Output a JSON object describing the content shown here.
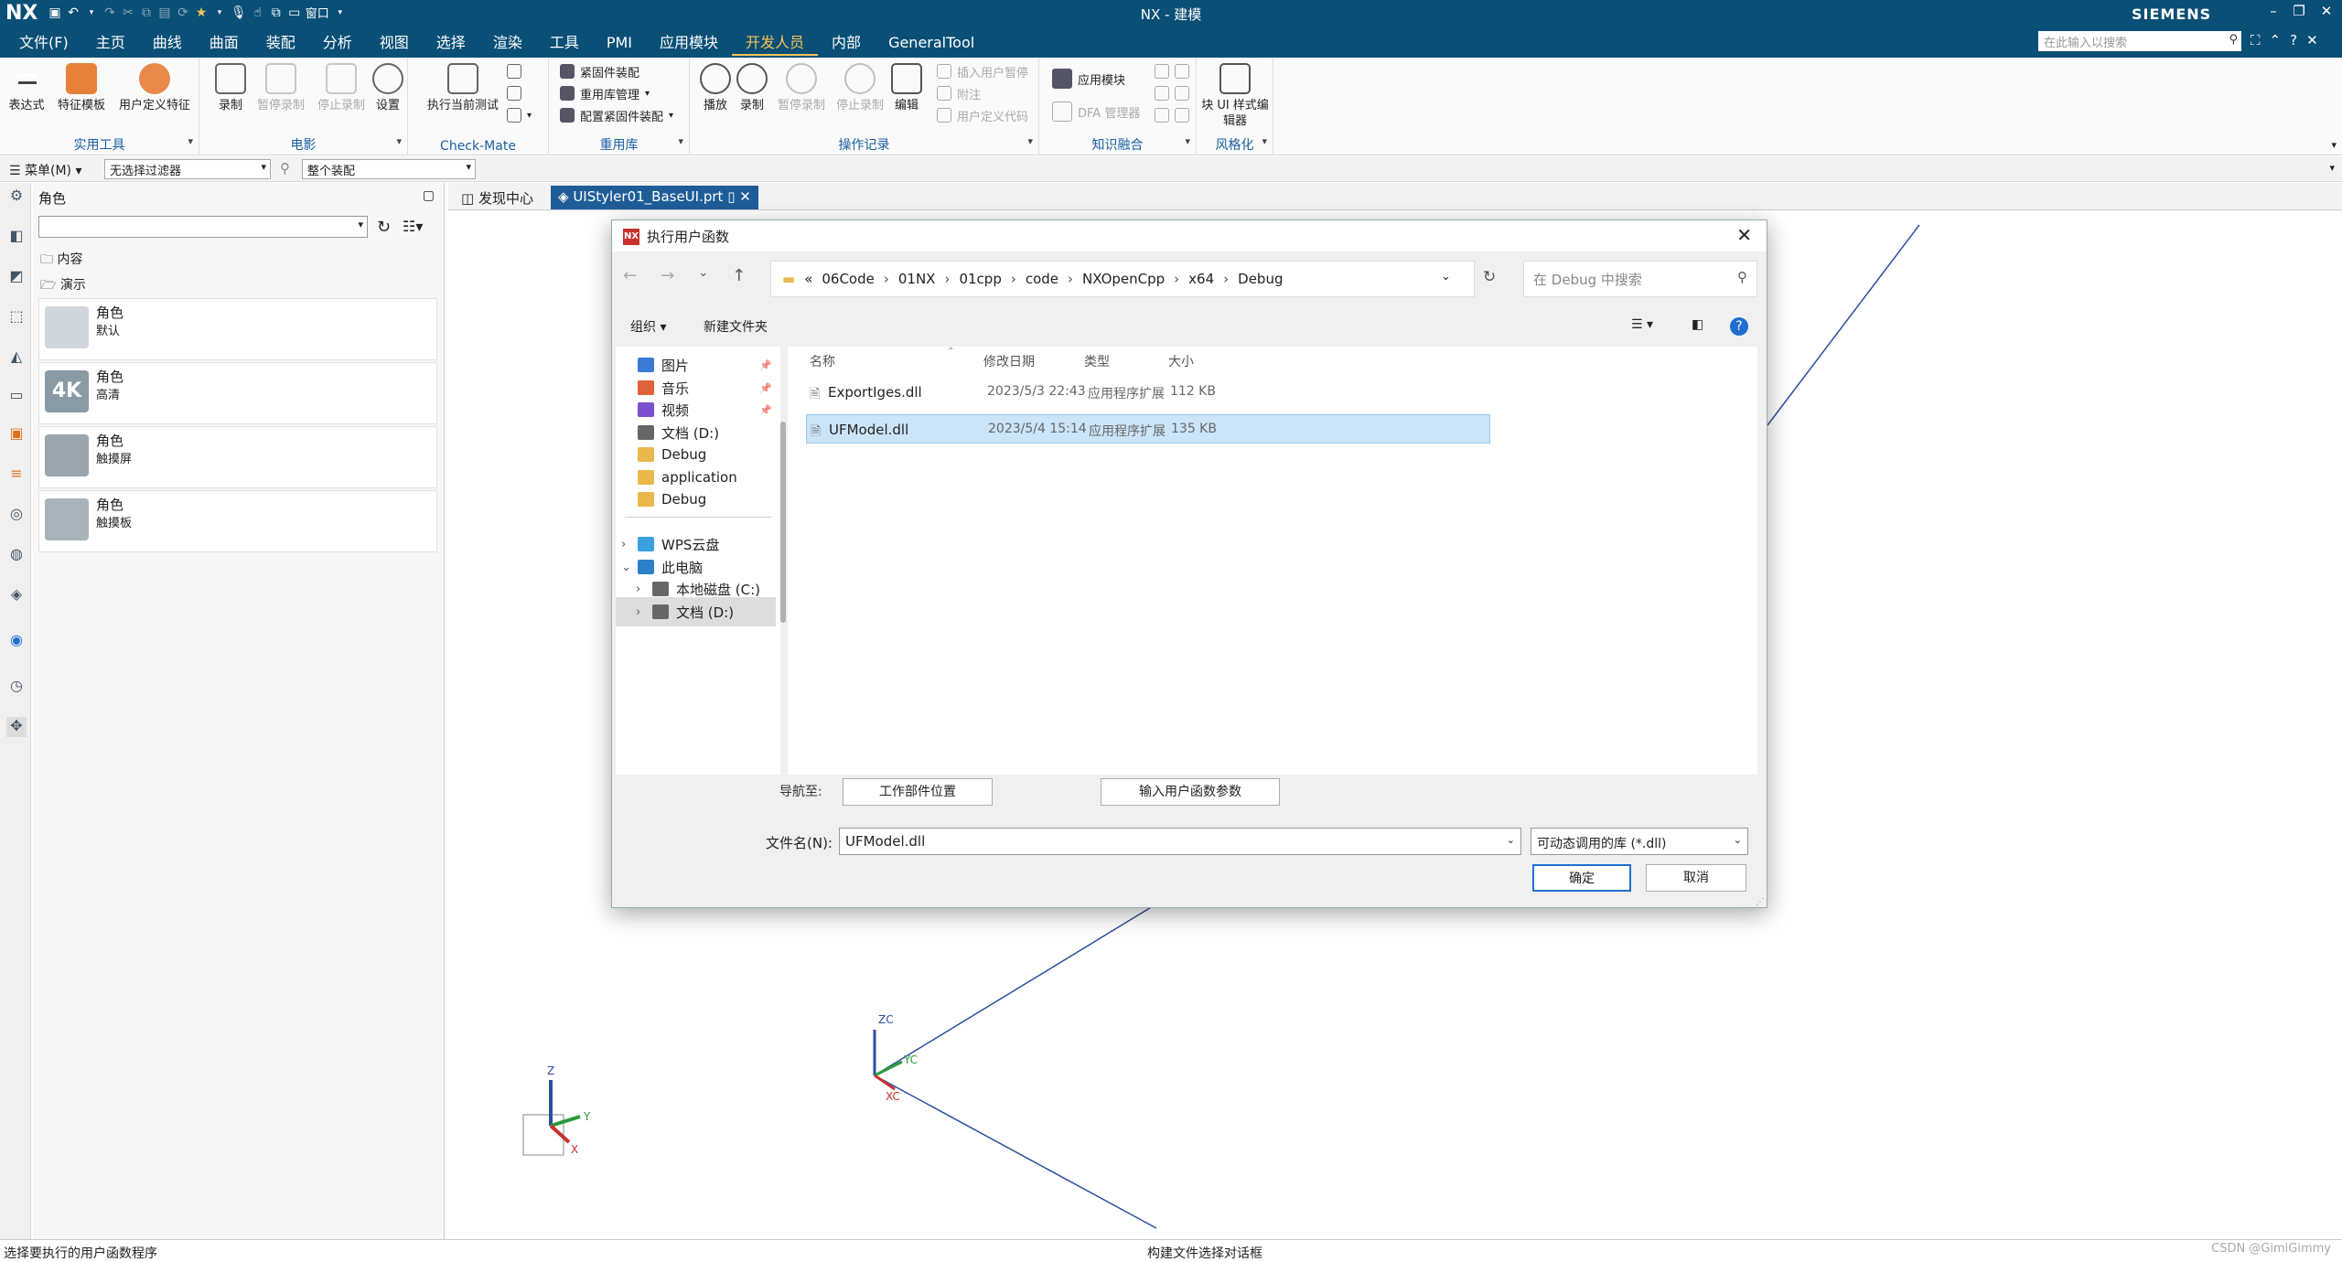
{
  "app": {
    "logo": "NX",
    "title": "NX - 建模",
    "brand": "SIEMENS",
    "quick_access_window": "窗口"
  },
  "menubar": {
    "items": [
      "文件(F)",
      "主页",
      "曲线",
      "曲面",
      "装配",
      "分析",
      "视图",
      "选择",
      "渲染",
      "工具",
      "PMI",
      "应用模块",
      "开发人员",
      "内部",
      "GeneralTool"
    ],
    "active": "开发人员",
    "search_placeholder": "在此输入以搜索"
  },
  "ribbon": {
    "groups": [
      {
        "title": "实用工具",
        "buttons": [
          "表达式",
          "特征模板",
          "用户定义特征"
        ]
      },
      {
        "title": "电影",
        "buttons": [
          "录制",
          "暂停录制",
          "停止录制",
          "设置"
        ]
      },
      {
        "title": "Check-Mate",
        "buttons": [
          "执行当前测试"
        ]
      },
      {
        "title": "重用库",
        "buttons": [
          "紧固件装配",
          "重用库管理",
          "配置紧固件装配"
        ]
      },
      {
        "title": "操作记录",
        "buttons": [
          "播放",
          "录制",
          "暂停录制",
          "停止录制",
          "编辑",
          "插入用户暂停",
          "附注",
          "用户定义代码"
        ]
      },
      {
        "title": "知识融合",
        "buttons": [
          "应用模块",
          "DFA 管理器"
        ]
      },
      {
        "title": "风格化",
        "buttons": [
          "块 UI 样式编辑器"
        ]
      }
    ]
  },
  "filterbar": {
    "menu_label": "菜单(M)",
    "filter_value": "无选择过滤器",
    "scope_value": "整个装配"
  },
  "nav_panel": {
    "title": "角色",
    "tree": [
      "内容",
      "演示"
    ],
    "roles": [
      {
        "title": "角色",
        "subtitle": "默认"
      },
      {
        "title": "角色",
        "subtitle": "高清"
      },
      {
        "title": "角色",
        "subtitle": "触摸屏"
      },
      {
        "title": "角色",
        "subtitle": "触摸板"
      }
    ]
  },
  "tabs": {
    "items": [
      "发现中心",
      "UIStyler01_BaseUI.prt"
    ],
    "active": "UIStyler01_BaseUI.prt"
  },
  "viewport": {
    "axes": {
      "zc": "ZC",
      "yc": "YC",
      "xc": "XC",
      "z": "Z",
      "y": "Y",
      "x": "X"
    }
  },
  "dialog": {
    "title": "执行用户函数",
    "path": [
      "«",
      "06Code",
      "01NX",
      "01cpp",
      "code",
      "NXOpenCpp",
      "x64",
      "Debug"
    ],
    "search_placeholder": "在 Debug 中搜索",
    "organize": "组织",
    "new_folder": "新建文件夹",
    "sidebar": [
      {
        "label": "图片",
        "icon": "picture-icon",
        "pinned": true
      },
      {
        "label": "音乐",
        "icon": "music-icon",
        "pinned": true
      },
      {
        "label": "视频",
        "icon": "video-icon",
        "pinned": true
      },
      {
        "label": "文档 (D:)",
        "icon": "drive-icon",
        "pinned": false
      },
      {
        "label": "Debug",
        "icon": "folder-icon",
        "pinned": false
      },
      {
        "label": "application",
        "icon": "folder-icon",
        "pinned": false
      },
      {
        "label": "Debug",
        "icon": "folder-icon",
        "pinned": false
      },
      {
        "label": "WPS云盘",
        "icon": "cloud-icon",
        "pinned": false
      },
      {
        "label": "此电脑",
        "icon": "computer-icon",
        "pinned": false
      },
      {
        "label": "本地磁盘 (C:)",
        "icon": "drive-icon",
        "pinned": false
      },
      {
        "label": "文档 (D:)",
        "icon": "drive-icon",
        "pinned": false
      }
    ],
    "columns": [
      "名称",
      "修改日期",
      "类型",
      "大小"
    ],
    "files": [
      {
        "name": "ExportIges.dll",
        "date": "2023/5/3 22:43",
        "type": "应用程序扩展",
        "size": "112 KB",
        "selected": false
      },
      {
        "name": "UFModel.dll",
        "date": "2023/5/4 15:14",
        "type": "应用程序扩展",
        "size": "135 KB",
        "selected": true
      }
    ],
    "navigate_label": "导航至:",
    "btn_work_part": "工作部件位置",
    "btn_params": "输入用户函数参数",
    "filename_label": "文件名(N):",
    "filename_value": "UFModel.dll",
    "filetype": "可动态调用的库 (*.dll)",
    "ok": "确定",
    "cancel": "取消"
  },
  "status": {
    "left": "选择要执行的用户函数程序",
    "center": "构建文件选择对话框",
    "watermark": "CSDN @GimiGimmy"
  },
  "colors": {
    "titlebar": "#0a4f75",
    "accent": "#f8c45a",
    "tab_active": "#1f5d99",
    "selection": "#cce4f7"
  }
}
